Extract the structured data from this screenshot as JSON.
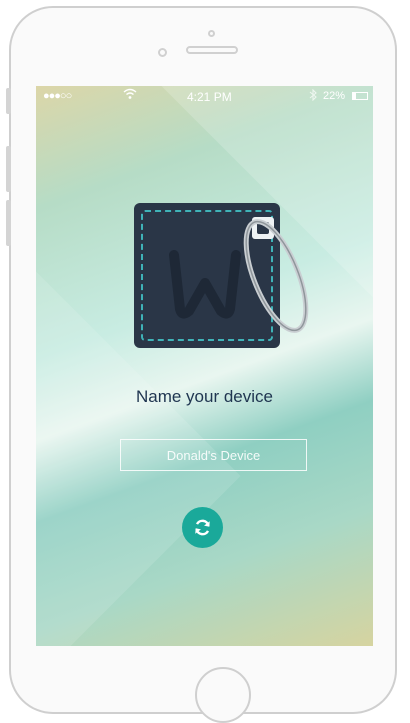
{
  "status_bar": {
    "signal": "●●●○○",
    "wifi_icon": "wifi-icon",
    "time": "4:21 PM",
    "bluetooth_icon": "bluetooth-icon",
    "battery": "22%",
    "battery_level": 0.22
  },
  "device_image": {
    "icon": "key-fob-icon"
  },
  "main": {
    "title": "Name your device",
    "device_name_placeholder": "Donald's Device",
    "refresh_icon": "refresh-icon"
  },
  "colors": {
    "accent": "#1aa99a",
    "title_text": "#1f3550",
    "tag_body": "#2a3647",
    "stitch": "#3fb3b8"
  }
}
